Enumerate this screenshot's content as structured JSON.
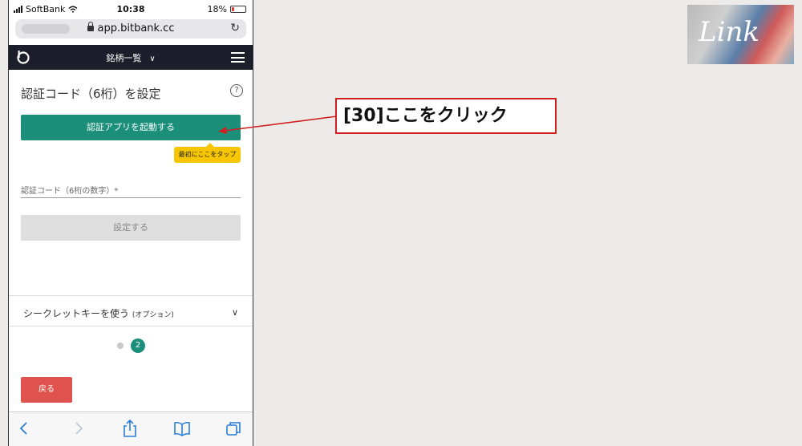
{
  "status_bar": {
    "carrier": "SoftBank",
    "time": "10:38",
    "battery": "18%",
    "battery_level": 0.18
  },
  "browser": {
    "url": "app.bitbank.cc"
  },
  "app_nav": {
    "title": "銘柄一覧"
  },
  "page": {
    "title": "認証コード（6桁）を設定",
    "launch_button": "認証アプリを起動する",
    "tooltip": "最初にここをタップ",
    "code_label": "認証コード（6桁の数字）*",
    "set_button": "設定する",
    "secret_key_label": "シークレットキーを使う",
    "secret_key_option": "(オプション)",
    "step_current": "2",
    "back_button": "戻る"
  },
  "annotation": {
    "text": "[30]ここをクリック",
    "color": "#d11f1f"
  },
  "brand": {
    "logo_text": "Link"
  },
  "colors": {
    "accent": "#1b8f7a",
    "danger": "#e0524e",
    "nav_bg": "#1c1f2b",
    "tooltip": "#f7c600"
  }
}
